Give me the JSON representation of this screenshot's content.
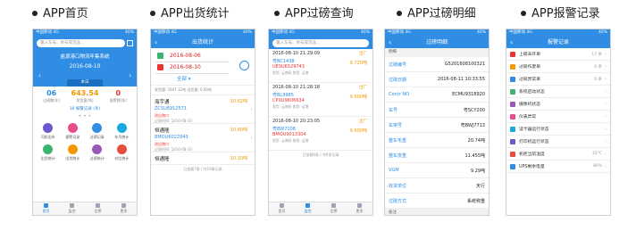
{
  "columns": [
    {
      "title": "APP首页"
    },
    {
      "title": "APP出货统计"
    },
    {
      "title": "APP过磅查询"
    },
    {
      "title": "APP过磅明细"
    },
    {
      "title": "APP报警记录"
    }
  ],
  "status_bar": {
    "carrier": "中国移动 4G",
    "time": "10:33",
    "battery": "40%"
  },
  "tabbar": [
    "首页",
    "监控",
    "告警",
    "更多"
  ],
  "home": {
    "search_placeholder": "输入车号、单号或货品...",
    "company": "盐源港口物流年集系统",
    "date": "2016-08-10",
    "today_label": "本日",
    "stats": [
      {
        "value": "06",
        "label": "过磅数(车)",
        "color": "#2f8de4"
      },
      {
        "value": "643.54",
        "label": "发货量(吨)",
        "color": "#f39800"
      },
      {
        "value": "0",
        "label": "报警数(条)",
        "color": "#e33333"
      }
    ],
    "sub_text": "18 报警记录 (条)",
    "grid": [
      {
        "label": "司机出车",
        "color": "#6a5acd"
      },
      {
        "label": "报警记录",
        "color": "#e84c8b"
      },
      {
        "label": "过磅记录",
        "color": "#2f8de4"
      },
      {
        "label": "车号统计",
        "color": "#1aa8e0"
      },
      {
        "label": "出货统计",
        "color": "#3cb371"
      },
      {
        "label": "出货统计",
        "color": "#f39800"
      },
      {
        "label": "过磅统计",
        "color": "#9b59b6"
      },
      {
        "label": "对比统计",
        "color": "#e74c3c"
      }
    ]
  },
  "ship": {
    "title": "出货统计",
    "date_from": "2016-08-06",
    "date_to": "2016-08-10",
    "select": "全部",
    "summary": "发货量: 1947.31吨   出货量: 0.00吨",
    "items": [
      {
        "name": "海宇通",
        "weight": "10.62吨",
        "code": "ZCSU6912571",
        "tag": "进出港口",
        "time": "过磅时间: 2016-08-10"
      },
      {
        "name": "恒通隆",
        "weight": "10.60吨",
        "code": "BMOU6022843",
        "tag": "进出港口",
        "time": "过磅时间: 2016-08-10"
      },
      {
        "name": "恒通隆",
        "weight": "10.10吨",
        "code": "",
        "tag": "",
        "time": ""
      }
    ],
    "footer": "已加载7条 / 共19条记录"
  },
  "weigh": {
    "search_placeholder": "输入车号、单号或货品...",
    "items": [
      {
        "time": "2016-08-10 21:29:09",
        "dir": "出厂",
        "plate": "粤BC1438",
        "weight": "9.720吨",
        "container": "UESU6529743",
        "meta": "发货: 云南码 收货: 运港"
      },
      {
        "time": "2016-08-10 21:28:18",
        "dir": "出厂",
        "plate": "粤BL9985",
        "weight": "9.600吨",
        "container": "CPXU9606634",
        "meta": "发货: 云南码 收货: 运港"
      },
      {
        "time": "2016-08-10 20:23:05",
        "dir": "出厂",
        "plate": "粤BW7108",
        "weight": "9.600吨",
        "container": "BMOU9013304",
        "meta": "发货: 云南码 收货: 运港"
      }
    ],
    "footer": "已加载6条 / 共6条记录"
  },
  "detail": {
    "title": "过磅明细",
    "section1": "明细",
    "rows": [
      {
        "key": "过磅编号",
        "value": "G5201608100321"
      },
      {
        "key": "过磅日期",
        "value": "2016-08-11 10:33:55"
      },
      {
        "key": "Contr NO",
        "value": "ECMU9318920"
      },
      {
        "key": "车号",
        "value": "粤SCY200"
      },
      {
        "key": "车架号",
        "value": "粤BWJ7713"
      },
      {
        "key": "整车毛重",
        "value": "20.74吨"
      },
      {
        "key": "整车皮重",
        "value": "11.455吨"
      },
      {
        "key": "VGM",
        "value": "9.29吨"
      },
      {
        "key": "收货单位",
        "value": "天行"
      },
      {
        "key": "过磅方式",
        "value": "系统称重"
      }
    ],
    "section2": "备注"
  },
  "alarm": {
    "title": "报警记录",
    "rows": [
      {
        "label": "上磅未开单",
        "value": "17 条",
        "color": "#e33"
      },
      {
        "label": "过磅作废单",
        "value": "0 条",
        "color": "#f39800"
      },
      {
        "label": "过磅异常单",
        "value": "0 条",
        "color": "#2f8de4"
      },
      {
        "label": "系统启动状态",
        "value": "",
        "color": "#3cb371"
      },
      {
        "label": "摄像机状态",
        "value": "",
        "color": "#9b59b6"
      },
      {
        "label": "仪表异常",
        "value": "",
        "color": "#e84c8b"
      },
      {
        "label": "读卡器运行状态",
        "value": "",
        "color": "#1aa8e0"
      },
      {
        "label": "打印机运行状态",
        "value": "",
        "color": "#6a5acd"
      },
      {
        "label": "机柜当前温度",
        "value": "32°C",
        "color": "#e74c3c"
      },
      {
        "label": "UPS剩余电量",
        "value": "80%",
        "color": "#2f8de4"
      }
    ]
  }
}
